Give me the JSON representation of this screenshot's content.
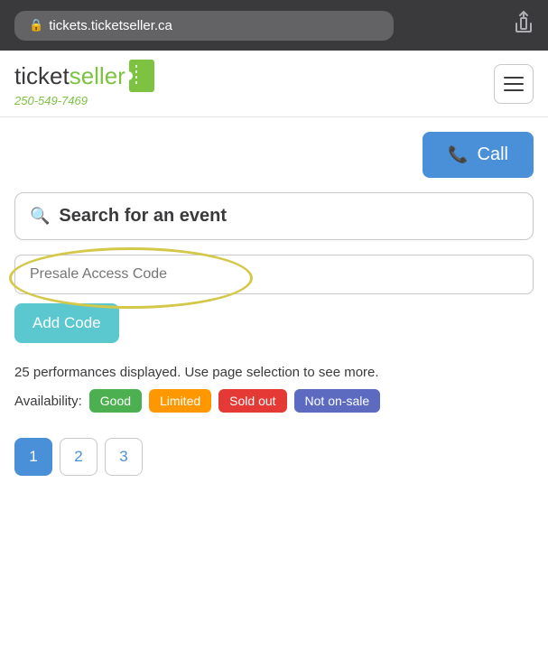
{
  "browser": {
    "url": "tickets.ticketseller.ca",
    "share_icon": "⬆"
  },
  "header": {
    "logo_ticket": "ticket",
    "logo_seller": "seller",
    "phone": "250-549-7469",
    "menu_label": "Menu"
  },
  "call_button": {
    "label": "Call"
  },
  "search": {
    "placeholder": "Search for an event"
  },
  "presale": {
    "placeholder": "Presale Access Code",
    "add_button_label": "Add Code"
  },
  "info": {
    "performances_text": "25 performances displayed. Use page selection to see more.",
    "availability_label": "Availability:",
    "badges": [
      {
        "label": "Good",
        "class": "badge-good"
      },
      {
        "label": "Limited",
        "class": "badge-limited"
      },
      {
        "label": "Sold out",
        "class": "badge-soldout"
      },
      {
        "label": "Not on-sale",
        "class": "badge-not-onsale"
      }
    ]
  },
  "pagination": {
    "pages": [
      "1",
      "2",
      "3"
    ],
    "active_page": "1"
  }
}
